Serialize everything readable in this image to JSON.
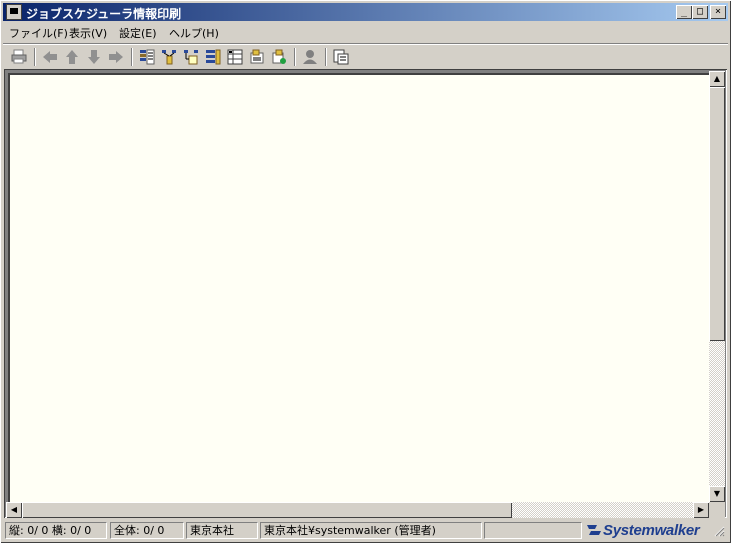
{
  "window": {
    "title": "ジョブスケジューラ情報印刷",
    "minimize": "_",
    "maximize": "□",
    "close": "×"
  },
  "menu": {
    "items": [
      {
        "label": "ファイル(F)"
      },
      {
        "label": "表示(V)"
      },
      {
        "label": "設定(E)"
      },
      {
        "label": "ヘルプ(H)"
      }
    ]
  },
  "toolbar": {
    "icons": [
      "print-icon",
      "back-arrow-icon",
      "up-arrow-icon",
      "down-arrow-icon",
      "forward-arrow-icon",
      "job-list-icon",
      "network-icon",
      "network-tree-icon",
      "job-group-icon",
      "calendar-list-icon",
      "project-icon",
      "export-icon",
      "user-icon",
      "preview-icon"
    ]
  },
  "statusbar": {
    "vertical": "縦:  0/  0 横:  0/  0",
    "total": "全体:   0/   0",
    "location": "東京本社",
    "user": "東京本社¥systemwalker (管理者)",
    "brand": "Systemwalker"
  },
  "colors": {
    "titlebar_start": "#0a246a",
    "titlebar_end": "#a6caf0",
    "content_bg": "#fffff5",
    "brand": "#1f3f8f"
  }
}
